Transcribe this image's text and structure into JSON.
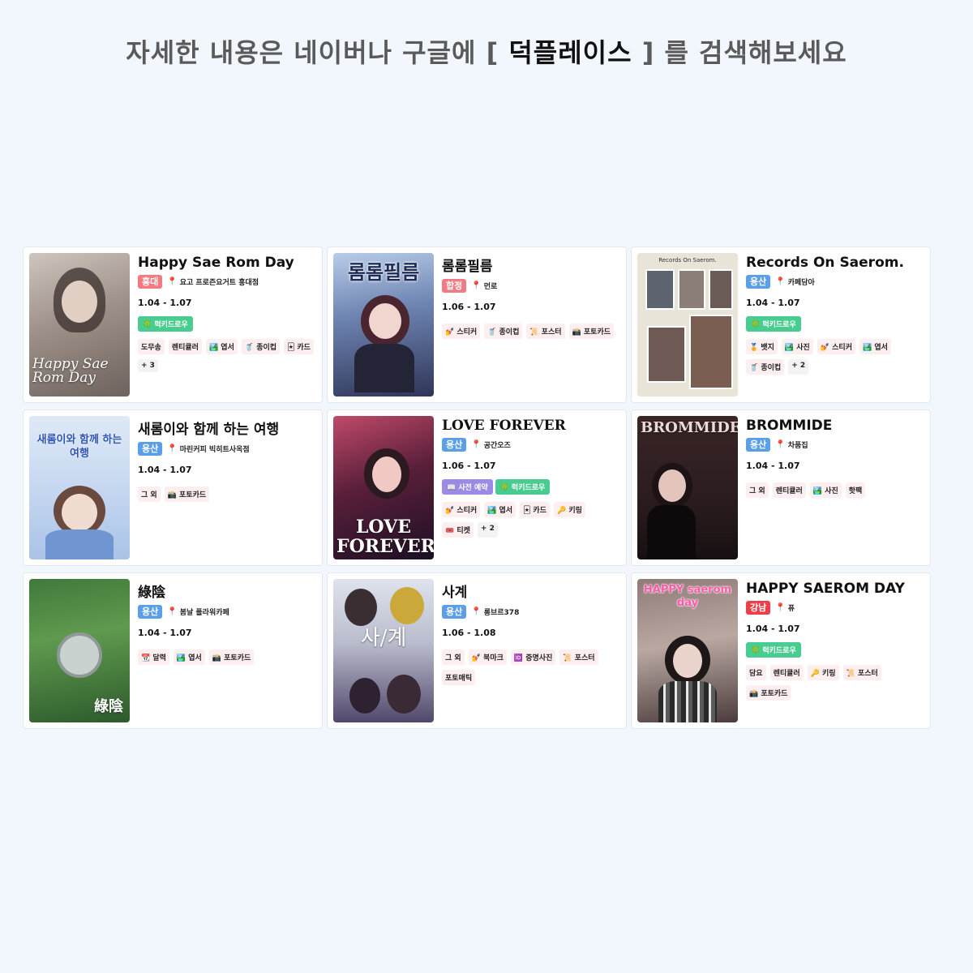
{
  "header": {
    "prefix": "자세한 내용은 네이버나 구글에 [",
    "keyword": "덕플레이스",
    "suffix": "] 를 검색해보세요"
  },
  "colors": {
    "page_bg": "#f1f7fd",
    "region_hongdae": "#f47a82",
    "region_hapjeong": "#f47a82",
    "region_yongsan": "#5a9fe8",
    "region_gangnam": "#ee3e48",
    "lucky_badge": "#49cc8f",
    "pre_badge": "#9b8ae6"
  },
  "cards": [
    {
      "title": "Happy Sae Rom Day",
      "region": "홍대",
      "place": "요고 프로즌요거트 홍대점",
      "date": "1.04 - 1.07",
      "badges": [
        "🍀 럭키드로우"
      ],
      "tags": [
        "도무송",
        "렌티큘러",
        "🏞️ 엽서",
        "🥤 종이컵",
        "🃏 카드"
      ],
      "more": "+ 3",
      "poster_text": "Happy Sae Rom Day"
    },
    {
      "title": "롬롬필름",
      "region": "합정",
      "place": "먼로",
      "date": "1.06 - 1.07",
      "badges": [],
      "tags": [
        "💅 스티커",
        "🥤 종이컵",
        "📜 포스터",
        "📸 포토카드"
      ],
      "more": "",
      "poster_text": "롬롬필름"
    },
    {
      "title": "Records On Saerom.",
      "region": "용산",
      "place": "카페담아",
      "date": "1.04 - 1.07",
      "badges": [
        "🍀 럭키드로우"
      ],
      "tags": [
        "🏅 뱃지",
        "🏞️ 사진",
        "💅 스티커",
        "🏞️ 엽서",
        "🥤 종이컵"
      ],
      "more": "+ 2",
      "poster_text": "Records On Saerom."
    },
    {
      "title": "새롬이와 함께 하는 여행",
      "region": "용산",
      "place": "마린커피 빅히트사옥점",
      "date": "1.04 - 1.07",
      "badges": [],
      "tags": [
        "그 외",
        "📸 포토카드"
      ],
      "more": "",
      "poster_text": "새롬이와 함께 하는 여행"
    },
    {
      "title": "LOVE FOREVER",
      "region": "용산",
      "place": "공간오즈",
      "date": "1.06 - 1.07",
      "badges": [
        "📖 사전 예약",
        "🍀 럭키드로우"
      ],
      "tags": [
        "💅 스티커",
        "🏞️ 엽서",
        "🃏 카드",
        "🔑 키링",
        "🎟️ 티켓"
      ],
      "more": "+ 2",
      "poster_text": "LOVE FOREVER"
    },
    {
      "title": "BROMMIDE",
      "region": "용산",
      "place": "차품집",
      "date": "1.04 - 1.07",
      "badges": [],
      "tags": [
        "그 외",
        "렌티큘러",
        "🏞️ 사진",
        "핫팩"
      ],
      "more": "",
      "poster_text": "BROMMIDE"
    },
    {
      "title": "綠陰",
      "region": "용산",
      "place": "봄날 플라워카페",
      "date": "1.04 - 1.07",
      "badges": [],
      "tags": [
        "📆 달력",
        "🏞️ 엽서",
        "📸 포토카드"
      ],
      "more": "",
      "poster_text": "綠陰"
    },
    {
      "title": "사계",
      "region": "용산",
      "place": "롱브르378",
      "date": "1.06 - 1.08",
      "badges": [],
      "tags": [
        "그 외",
        "💅 북마크",
        "🆔 증명사진",
        "📜 포스터",
        "포토매틱"
      ],
      "more": "",
      "poster_text": "사/계"
    },
    {
      "title": "HAPPY SAEROM DAY",
      "region": "강남",
      "place": "퓨",
      "date": "1.04 - 1.07",
      "badges": [
        "🍀 럭키드로우"
      ],
      "tags": [
        "담요",
        "렌티큘러",
        "🔑 키링",
        "📜 포스터",
        "📸 포토카드"
      ],
      "more": "",
      "poster_text": "HAPPY saerom day"
    }
  ]
}
